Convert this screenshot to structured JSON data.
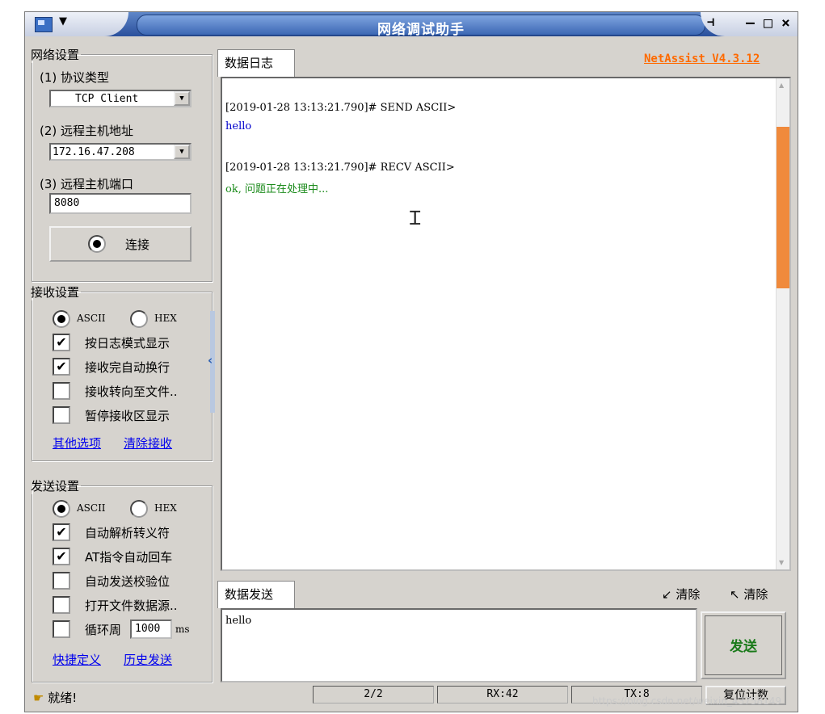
{
  "window": {
    "title": "网络调试助手",
    "menu_arrow": "▼",
    "pin": "⊣",
    "minimize": "–",
    "maximize": "□",
    "close": "×"
  },
  "net": {
    "legend": "网络设置",
    "protocol_label": "(1) 协议类型",
    "protocol_value": "TCP Client",
    "host_label": "(2) 远程主机地址",
    "host_value": "172.16.47.208",
    "port_label": "(3) 远程主机端口",
    "port_value": "8080",
    "connect_label": "连接"
  },
  "recv": {
    "legend": "接收设置",
    "ascii": "ASCII",
    "hex": "HEX",
    "mode": "ASCII",
    "options": [
      {
        "label": "按日志模式显示",
        "checked": true
      },
      {
        "label": "接收完自动换行",
        "checked": true
      },
      {
        "label": "接收转向至文件..",
        "checked": false
      },
      {
        "label": "暂停接收区显示",
        "checked": false
      }
    ],
    "link_other": "其他选项",
    "link_clear": "清除接收"
  },
  "send": {
    "legend": "发送设置",
    "ascii": "ASCII",
    "hex": "HEX",
    "mode": "ASCII",
    "options": [
      {
        "label": "自动解析转义符",
        "checked": true
      },
      {
        "label": "AT指令自动回车",
        "checked": true
      },
      {
        "label": "自动发送校验位",
        "checked": false
      },
      {
        "label": "打开文件数据源..",
        "checked": false
      }
    ],
    "loop_label": "循环周",
    "loop_value": "1000",
    "loop_unit": "ms",
    "link_shortcut": "快捷定义",
    "link_history": "历史发送"
  },
  "log": {
    "tab": "数据日志",
    "version": "NetAssist V4.3.12",
    "lines": [
      {
        "text": "[2019-01-28 13:13:21.790]# SEND ASCII>",
        "color": "#000000"
      },
      {
        "text": "hello",
        "color": "#0000cc"
      },
      {
        "text": "[2019-01-28 13:13:21.790]# RECV ASCII>",
        "color": "#000000"
      },
      {
        "text": "ok, 问题正在处理中...",
        "color": "#1a8a1a"
      }
    ],
    "scroll_up": "▲",
    "scroll_down": "▼"
  },
  "sendpane": {
    "tab": "数据发送",
    "clear1": "清除",
    "clear2": "清除",
    "text": "hello",
    "send_button": "发送"
  },
  "status": {
    "ready": "就绪!",
    "count": "2/2",
    "rx": "RX:42",
    "tx": "TX:8",
    "reset": "复位计数"
  },
  "watermark": "https://blog.csdn.net/weixin_43758149"
}
